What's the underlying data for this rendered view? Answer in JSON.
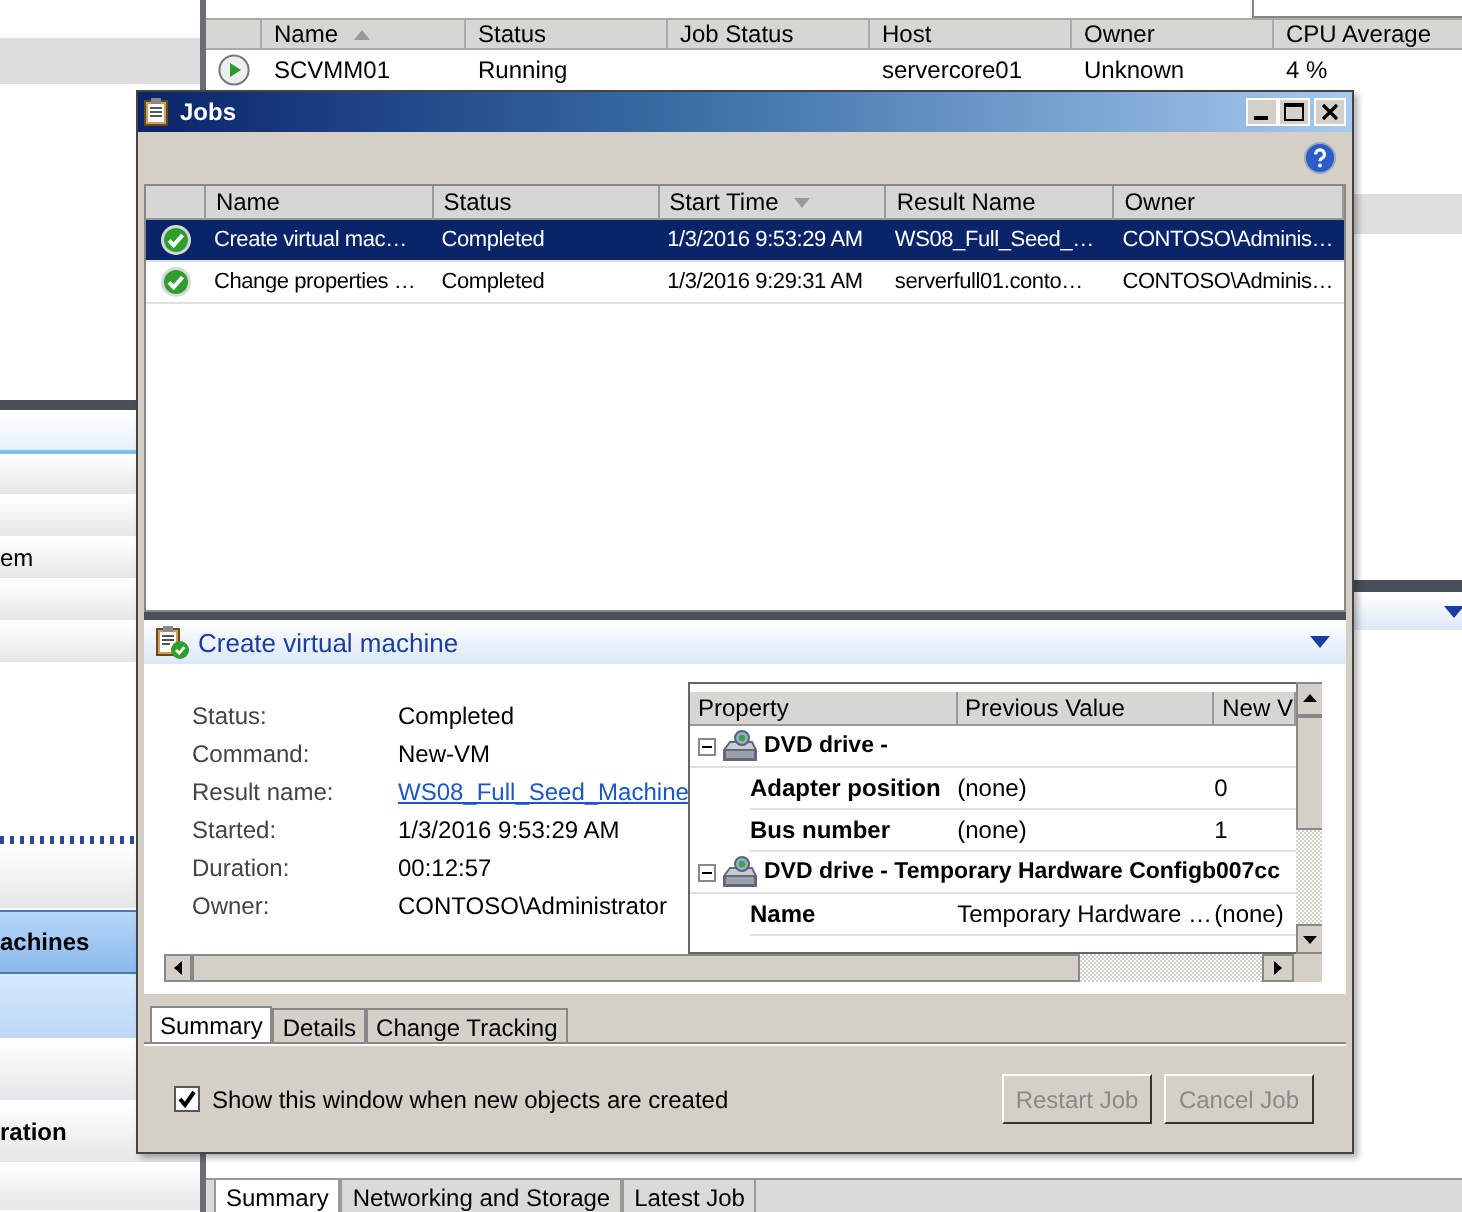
{
  "background": {
    "sidebar": {
      "items": [
        {
          "label": "em",
          "selected": false
        },
        {
          "label": "achines",
          "selected": true
        },
        {
          "label": "ration",
          "selected": false
        }
      ]
    },
    "vm_list": {
      "columns": [
        {
          "label": "Name",
          "sorted": true
        },
        {
          "label": "Status",
          "sorted": false
        },
        {
          "label": "Job Status",
          "sorted": false
        },
        {
          "label": "Host",
          "sorted": false
        },
        {
          "label": "Owner",
          "sorted": false
        },
        {
          "label": "CPU Average",
          "sorted": false
        }
      ],
      "rows": [
        {
          "name": "SCVMM01",
          "status": "Running",
          "host": "servercore01",
          "owner": "Unknown",
          "cpu_average": "4 %"
        }
      ]
    },
    "detail_tabs": [
      {
        "label": "Summary",
        "selected": true
      },
      {
        "label": "Networking and Storage",
        "selected": false
      },
      {
        "label": "Latest Job",
        "selected": false
      }
    ]
  },
  "jobs_window": {
    "title": "Jobs",
    "columns": [
      {
        "label": "Name",
        "sorted": false
      },
      {
        "label": "Status",
        "sorted": false
      },
      {
        "label": "Start Time",
        "sorted": true
      },
      {
        "label": "Result Name",
        "sorted": false
      },
      {
        "label": "Owner",
        "sorted": false
      }
    ],
    "rows": [
      {
        "name": "Create virtual mac…",
        "status": "Completed",
        "start_time": "1/3/2016 9:53:29 AM",
        "result_name": "WS08_Full_Seed_…",
        "owner": "CONTOSO\\Adminis…",
        "selected": true
      },
      {
        "name": "Change properties …",
        "status": "Completed",
        "start_time": "1/3/2016 9:29:31 AM",
        "result_name": "serverfull01.conto…",
        "owner": "CONTOSO\\Adminis…",
        "selected": false
      }
    ],
    "detail": {
      "title": "Create virtual machine",
      "fields": [
        {
          "label": "Status:",
          "value": "Completed",
          "kind": "text"
        },
        {
          "label": "Command:",
          "value": "New-VM",
          "kind": "text"
        },
        {
          "label": "Result name:",
          "value": "WS08_Full_Seed_Machine",
          "kind": "link"
        },
        {
          "label": "Started:",
          "value": "1/3/2016 9:53:29 AM",
          "kind": "text"
        },
        {
          "label": "Duration:",
          "value": "00:12:57",
          "kind": "text"
        },
        {
          "label": "Owner:",
          "value": "CONTOSO\\Administrator",
          "kind": "text"
        }
      ],
      "properties": {
        "columns": [
          "Property",
          "Previous Value",
          "New V"
        ],
        "groups": [
          {
            "name": "DVD drive -",
            "expanded": true,
            "children": [
              {
                "property": "Adapter position",
                "previous": "(none)",
                "new": "0"
              },
              {
                "property": "Bus number",
                "previous": "(none)",
                "new": "1"
              }
            ]
          },
          {
            "name": "DVD drive - Temporary Hardware Configb007cc",
            "expanded": true,
            "children": [
              {
                "property": "Name",
                "previous": "Temporary Hardware …",
                "new": "(none)"
              }
            ]
          }
        ]
      }
    },
    "tabs": [
      {
        "label": "Summary",
        "selected": true
      },
      {
        "label": "Details",
        "selected": false
      },
      {
        "label": "Change Tracking",
        "selected": false
      }
    ],
    "show_on_create": {
      "label": "Show this window when new objects are created",
      "checked": true
    },
    "buttons": [
      {
        "label": "Restart Job",
        "disabled": true
      },
      {
        "label": "Cancel Job",
        "disabled": true
      }
    ]
  }
}
